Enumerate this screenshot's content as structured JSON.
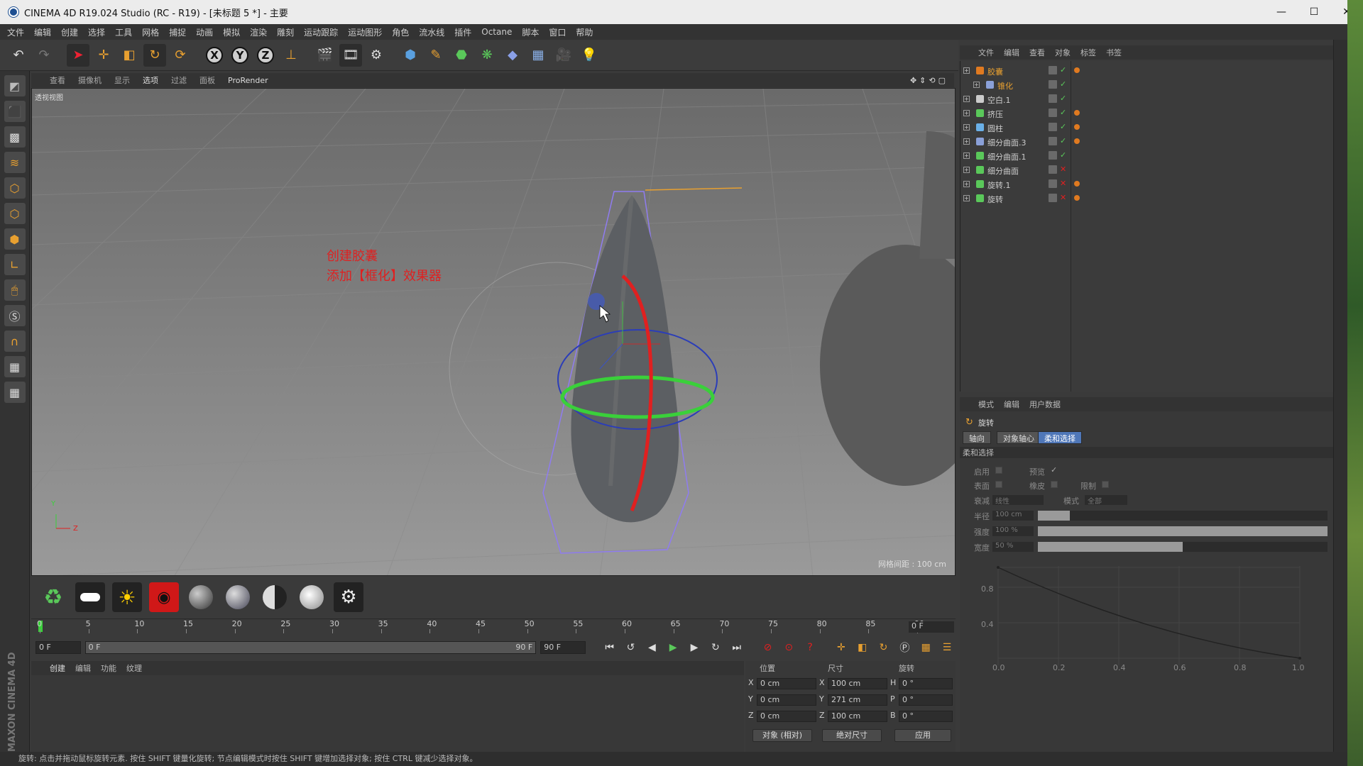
{
  "window": {
    "title": "CINEMA 4D R19.024 Studio (RC - R19) - [未标题 5 *] - 主要",
    "controls": [
      "—",
      "☐",
      "✕"
    ]
  },
  "menu": [
    "文件",
    "编辑",
    "创建",
    "选择",
    "工具",
    "网格",
    "捕捉",
    "动画",
    "模拟",
    "渲染",
    "雕刻",
    "运动跟踪",
    "运动图形",
    "角色",
    "流水线",
    "插件",
    "Octane",
    "脚本",
    "窗口",
    "帮助"
  ],
  "viewport": {
    "menu": [
      "查看",
      "摄像机",
      "显示",
      "选项",
      "过滤",
      "面板",
      "ProRender"
    ],
    "label": "透视视图",
    "grid_note": "网格间距 : 100 cm",
    "annotation_1": "创建胶囊",
    "annotation_2": "添加【框化】效果器",
    "axis_y": "Y",
    "axis_z": "Z"
  },
  "timeline": {
    "ticks": [
      "0",
      "5",
      "10",
      "15",
      "20",
      "25",
      "30",
      "35",
      "40",
      "45",
      "50",
      "55",
      "60",
      "65",
      "70",
      "75",
      "80",
      "85",
      "90"
    ],
    "end_field": "0 F",
    "start_frame": "0 F",
    "range_start": "0 F",
    "range_end": "90 F",
    "max_frame": "90 F"
  },
  "material_manager": {
    "tabs": [
      "创建",
      "编辑",
      "功能",
      "纹理"
    ]
  },
  "coordinates": {
    "headers": [
      "位置",
      "尺寸",
      "旋转"
    ],
    "rows": [
      {
        "axis": "X",
        "pos": "0 cm",
        "size_axis": "X",
        "size": "100 cm",
        "rot_axis": "H",
        "rot": "0 °"
      },
      {
        "axis": "Y",
        "pos": "0 cm",
        "size_axis": "Y",
        "size": "271 cm",
        "rot_axis": "P",
        "rot": "0 °"
      },
      {
        "axis": "Z",
        "pos": "0 cm",
        "size_axis": "Z",
        "size": "100 cm",
        "rot_axis": "B",
        "rot": "0 °"
      }
    ],
    "mode_1": "对象 (相对)",
    "mode_2": "绝对尺寸",
    "apply": "应用"
  },
  "object_manager": {
    "menu": [
      "文件",
      "编辑",
      "查看",
      "对象",
      "标签",
      "书签"
    ],
    "objects": [
      {
        "name": "胶囊",
        "level": 0,
        "color": "#e07a20",
        "active": true
      },
      {
        "name": "锥化",
        "level": 1,
        "color": "#8aa0d8",
        "active": true
      },
      {
        "name": "空白.1",
        "level": 0,
        "color": "#cccccc",
        "active": false
      },
      {
        "name": "挤压",
        "level": 0,
        "color": "#5ac85a",
        "active": false
      },
      {
        "name": "圆柱",
        "level": 0,
        "color": "#6ab0e8",
        "active": false
      },
      {
        "name": "细分曲面.3",
        "level": 0,
        "color": "#8aa0d8",
        "active": false
      },
      {
        "name": "细分曲面.1",
        "level": 0,
        "color": "#5ac85a",
        "active": false
      },
      {
        "name": "细分曲面",
        "level": 0,
        "color": "#5ac85a",
        "active": false
      },
      {
        "name": "旋转.1",
        "level": 0,
        "color": "#5ac85a",
        "active": false
      },
      {
        "name": "旋转",
        "level": 0,
        "color": "#5ac85a",
        "active": false
      }
    ]
  },
  "attributes": {
    "menu": [
      "模式",
      "编辑",
      "用户数据"
    ],
    "object_name": "旋转",
    "tabs": [
      "轴向",
      "对象轴心",
      "柔和选择"
    ],
    "section": "柔和选择",
    "enable": "启用",
    "preview": "预览",
    "surface": "表面",
    "rubber": "橡皮",
    "restrict": "限制",
    "falloff_label": "衰减",
    "falloff_value": "线性",
    "mode_label": "模式",
    "mode_value": "全部",
    "radius_label": "半径",
    "radius_value": "100 cm",
    "radius_fill": 0.11,
    "strength_label": "强度",
    "strength_value": "100 %",
    "strength_fill": 1.0,
    "width_label": "宽度",
    "width_value": "50 %",
    "width_fill": 0.5,
    "graph_y_ticks": [
      "0.8",
      "0.4"
    ],
    "graph_x_ticks": [
      "0.0",
      "0.2",
      "0.4",
      "0.6",
      "0.8",
      "1.0"
    ]
  },
  "status": "旋转: 点击并拖动鼠标旋转元素. 按住 SHIFT 键量化旋转; 节点编辑模式时按住 SHIFT 键增加选择对象; 按住 CTRL 键减少选择对象。",
  "branding": "MAXON CINEMA 4D"
}
